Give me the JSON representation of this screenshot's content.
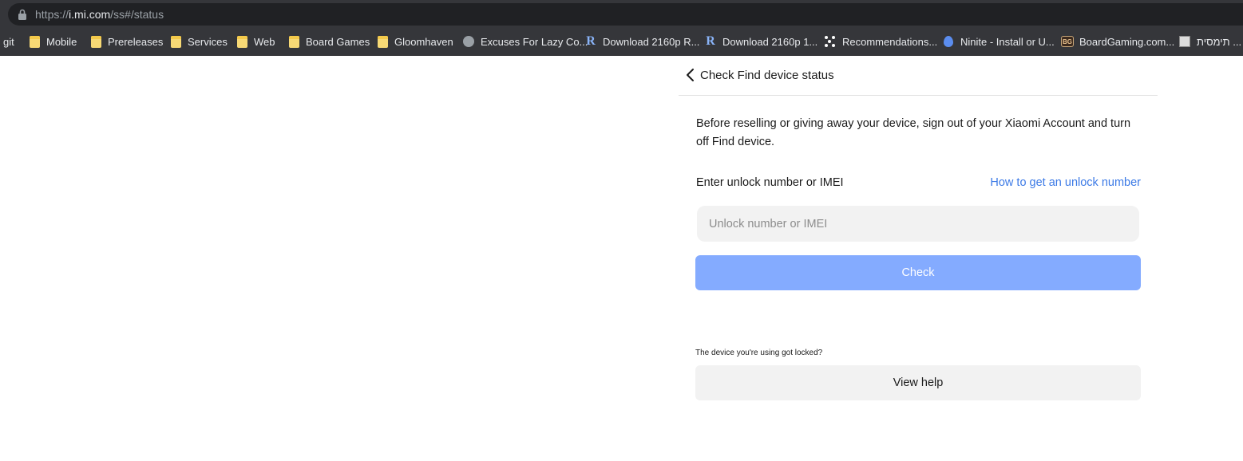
{
  "browser": {
    "url_prefix": "https://",
    "url_host": "i.mi.com",
    "url_path": "/ss#/status",
    "bookmarks": [
      {
        "label": "git",
        "icon": "none"
      },
      {
        "label": "Mobile",
        "icon": "folder-icon"
      },
      {
        "label": "Prereleases",
        "icon": "folder-icon"
      },
      {
        "label": "Services",
        "icon": "folder-icon"
      },
      {
        "label": "Web",
        "icon": "folder-icon"
      },
      {
        "label": "Board Games",
        "icon": "folder-icon"
      },
      {
        "label": "Gloomhaven",
        "icon": "folder-icon"
      },
      {
        "label": "Excuses For Lazy Co...",
        "icon": "globe-icon"
      },
      {
        "label": "Download 2160p R...",
        "icon": "r-logo-icon"
      },
      {
        "label": "Download 2160p 1...",
        "icon": "r-logo-icon"
      },
      {
        "label": "Recommendations...",
        "icon": "dots-icon"
      },
      {
        "label": "Ninite - Install or U...",
        "icon": "ninite-icon"
      },
      {
        "label": "BoardGaming.com...",
        "icon": "boardgaming-icon"
      },
      {
        "label": "תימסית ...",
        "icon": "image-icon"
      }
    ],
    "bg_badge": "BG"
  },
  "page": {
    "title": "Check Find device status",
    "intro": "Before reselling or giving away your device, sign out of your Xiaomi Account and turn off Find device.",
    "field_label": "Enter unlock number or IMEI",
    "help_link": "How to get an unlock number",
    "input_placeholder": "Unlock number or IMEI",
    "input_value": "",
    "check_label": "Check",
    "locked_note": "The device you're using got locked?",
    "help_button": "View help"
  },
  "colors": {
    "accent_link": "#3c7ae6",
    "check_button": "#84abff",
    "chrome_dark": "#35363a"
  }
}
